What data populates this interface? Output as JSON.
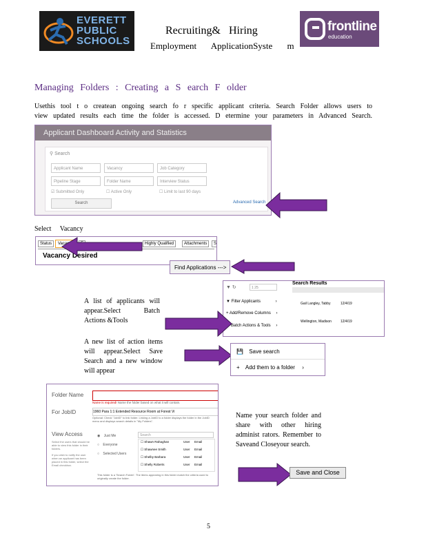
{
  "header": {
    "district_logo": {
      "line1": "EVERETT",
      "line2": "PUBLIC",
      "line3": "SCHOOLS"
    },
    "vendor_logo": {
      "name": "frontline",
      "sub": "education"
    },
    "title_line1": "Recruiting&   Hiring",
    "title_line2": "Employment ApplicationSyste m"
  },
  "section_title": "Managing Folders : Creating a S earch F older",
  "intro": "Usethis tool t o createan ongoing search fo r specific applicant criteria. Search Folder allows users to view updated results each time the folder is accessed. D etermine your parameters in Advanced Search.",
  "dashboard": {
    "title": "Applicant Dashboard Activity and Statistics",
    "search_label": "Search",
    "fields": [
      "Applicant Name",
      "Vacancy",
      "Job Category",
      "Pipeline Stage",
      "Folder Name",
      "Interview Status"
    ],
    "checkboxes": [
      "Submitted Only",
      "Active Only",
      "Limit to last 90 days"
    ],
    "search_button": "Search",
    "advanced_link": "Advanced Search"
  },
  "step_select_vacancy": "Select Vacancy",
  "tabs": {
    "items": [
      "Status",
      "Vacancy",
      "E",
      "Highly Qualified",
      "Attachments",
      "S"
    ],
    "heading": "Vacancy Desired",
    "find_button": "Find Applications --->"
  },
  "results_menu": {
    "counter": "1 25",
    "title": "Search Results",
    "items": [
      "Filter Applicants",
      "Add/Remove Columns",
      "Batch Actions & Tools"
    ],
    "row1": "Gail Langley, Tabby",
    "row2": "Wellington, Madison",
    "date": "12/4/19"
  },
  "caption_list": "A list of applicants will appear.Select Batch Actions &Tools",
  "caption_actions": "A new list of action items will appear.Select Save Search and a new window will appear",
  "action_menu": {
    "save": "Save search",
    "add_folder": "Add them to a folder"
  },
  "folder_dialog": {
    "folder_name_label": "Folder Name",
    "required_note": "Name is required!",
    "folder_note": "Name the folder based on what it will contain.",
    "jobid_label": "For JobID",
    "jobid_value": "1960  Para  1:1  Extended Resource Room at Forest Vi",
    "optional_text": "Optional: Check \"JobID\" to link folder. Linking a JobID to a folder displays the folder in the JobID menu and displays search details in \"My Folders\".",
    "view_access_label": "View Access",
    "view_access_help": "Select the users that should be able to view this folder in their folders.",
    "view_access_help2": "If you wish to notify the user when an applicant has been placed in this folder, select the Email checkbox.",
    "radios": [
      "Just Me",
      "Everyone",
      "Selected Users"
    ],
    "search_placeholder": "Search",
    "users": [
      "Shawn Rahaghan",
      "Shawnee Smith",
      "Shelby Barbara",
      "Shelly Roberts"
    ],
    "user_col": "User",
    "email_col": "Email",
    "footer": "This folder is a 'Search Folder'. The items appearing in this folder match the criteria used to originally create the folder."
  },
  "caption_name": "Name your search folder and share with other hiring administ rators. Remember to Saveand Closeyour search.",
  "save_close_button": "Save and Close",
  "page_number": "5",
  "colors": {
    "accent": "#5b2c83",
    "arrow": "#7b2d9e"
  }
}
